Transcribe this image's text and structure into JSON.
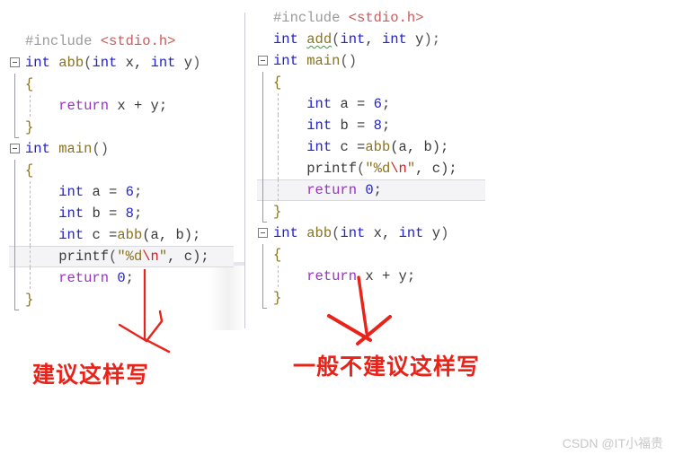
{
  "page": {
    "background": "#ffffff",
    "watermark": "CSDN @IT小福贵"
  },
  "colors": {
    "preprocessor": "#9a9a9a",
    "include_path": "#d05a5a",
    "keyword_type": "#2222cc",
    "keyword_return": "#9b30c8",
    "function_name": "#8a7320",
    "string_literal": "#8a7320",
    "escape_sequence": "#cc2222",
    "annotation_red": "#e8231a",
    "squiggle_green": "#2f9e2f",
    "current_line_highlight": "#f4f4f6"
  },
  "left_editor": {
    "name": "recommended-code",
    "lines": [
      {
        "fold": false,
        "rail": "none",
        "guide": false,
        "highlight": false,
        "tokens": [
          {
            "t": "#include ",
            "c": "k-pre"
          },
          {
            "t": "<stdio.h>",
            "c": "k-inc"
          }
        ]
      },
      {
        "fold": true,
        "rail": "none",
        "guide": false,
        "highlight": false,
        "tokens": [
          {
            "t": "int ",
            "c": "k-type"
          },
          {
            "t": "abb",
            "c": "k-fn"
          },
          {
            "t": "(",
            "c": "k-punct"
          },
          {
            "t": "int ",
            "c": "k-type"
          },
          {
            "t": "x, ",
            "c": "k-plain"
          },
          {
            "t": "int ",
            "c": "k-type"
          },
          {
            "t": "y",
            "c": "k-plain"
          },
          {
            "t": ")",
            "c": "k-punct"
          }
        ]
      },
      {
        "fold": false,
        "rail": "mid",
        "guide": false,
        "highlight": false,
        "tokens": [
          {
            "t": "{",
            "c": "k-brace"
          }
        ]
      },
      {
        "fold": false,
        "rail": "mid",
        "guide": true,
        "highlight": false,
        "tokens": [
          {
            "t": "    ",
            "c": "k-plain"
          },
          {
            "t": "return ",
            "c": "k-ret"
          },
          {
            "t": "x + y;",
            "c": "k-plain"
          }
        ]
      },
      {
        "fold": false,
        "rail": "end",
        "guide": false,
        "highlight": false,
        "tokens": [
          {
            "t": "}",
            "c": "k-brace"
          }
        ]
      },
      {
        "fold": true,
        "rail": "none",
        "guide": false,
        "highlight": false,
        "tokens": [
          {
            "t": "int ",
            "c": "k-type"
          },
          {
            "t": "main",
            "c": "k-fn"
          },
          {
            "t": "()",
            "c": "k-punct"
          }
        ]
      },
      {
        "fold": false,
        "rail": "mid",
        "guide": false,
        "highlight": false,
        "tokens": [
          {
            "t": "{",
            "c": "k-brace"
          }
        ]
      },
      {
        "fold": false,
        "rail": "mid",
        "guide": true,
        "highlight": false,
        "tokens": [
          {
            "t": "    ",
            "c": "k-plain"
          },
          {
            "t": "int ",
            "c": "k-type"
          },
          {
            "t": "a = ",
            "c": "k-plain"
          },
          {
            "t": "6",
            "c": "k-num"
          },
          {
            "t": ";",
            "c": "k-plain"
          }
        ]
      },
      {
        "fold": false,
        "rail": "mid",
        "guide": true,
        "highlight": false,
        "tokens": [
          {
            "t": "    ",
            "c": "k-plain"
          },
          {
            "t": "int ",
            "c": "k-type"
          },
          {
            "t": "b = ",
            "c": "k-plain"
          },
          {
            "t": "8",
            "c": "k-num"
          },
          {
            "t": ";",
            "c": "k-plain"
          }
        ]
      },
      {
        "fold": false,
        "rail": "mid",
        "guide": true,
        "highlight": false,
        "tokens": [
          {
            "t": "    ",
            "c": "k-plain"
          },
          {
            "t": "int ",
            "c": "k-type"
          },
          {
            "t": "c =",
            "c": "k-plain"
          },
          {
            "t": "abb",
            "c": "k-fn"
          },
          {
            "t": "(a, b);",
            "c": "k-plain"
          }
        ]
      },
      {
        "fold": false,
        "rail": "mid",
        "guide": true,
        "highlight": true,
        "tokens": [
          {
            "t": "    ",
            "c": "k-plain"
          },
          {
            "t": "printf",
            "c": "k-plain"
          },
          {
            "t": "(",
            "c": "k-punct"
          },
          {
            "t": "\"%d",
            "c": "k-str"
          },
          {
            "t": "\\n",
            "c": "k-esc"
          },
          {
            "t": "\"",
            "c": "k-str"
          },
          {
            "t": ", c);",
            "c": "k-plain"
          }
        ]
      },
      {
        "fold": false,
        "rail": "mid",
        "guide": true,
        "highlight": false,
        "tokens": [
          {
            "t": "    ",
            "c": "k-plain"
          },
          {
            "t": "return ",
            "c": "k-ret"
          },
          {
            "t": "0",
            "c": "k-num"
          },
          {
            "t": ";",
            "c": "k-plain"
          }
        ]
      },
      {
        "fold": false,
        "rail": "end",
        "guide": false,
        "highlight": false,
        "tokens": [
          {
            "t": "}",
            "c": "k-brace"
          }
        ]
      }
    ]
  },
  "right_editor": {
    "name": "not-recommended-code",
    "lines": [
      {
        "fold": false,
        "rail": "none",
        "guide": false,
        "highlight": false,
        "tokens": [
          {
            "t": "#include ",
            "c": "k-pre"
          },
          {
            "t": "<stdio.h>",
            "c": "k-inc"
          }
        ]
      },
      {
        "fold": false,
        "rail": "none",
        "guide": false,
        "highlight": false,
        "tokens": [
          {
            "t": "int ",
            "c": "k-type"
          },
          {
            "t": "add",
            "c": "k-fn squiggle"
          },
          {
            "t": "(",
            "c": "k-punct"
          },
          {
            "t": "int",
            "c": "k-type"
          },
          {
            "t": ", ",
            "c": "k-plain"
          },
          {
            "t": "int ",
            "c": "k-type"
          },
          {
            "t": "y",
            "c": "k-plain"
          },
          {
            "t": ");",
            "c": "k-punct"
          }
        ]
      },
      {
        "fold": true,
        "rail": "none",
        "guide": false,
        "highlight": false,
        "tokens": [
          {
            "t": "int ",
            "c": "k-type"
          },
          {
            "t": "main",
            "c": "k-fn"
          },
          {
            "t": "()",
            "c": "k-punct"
          }
        ]
      },
      {
        "fold": false,
        "rail": "mid",
        "guide": false,
        "highlight": false,
        "tokens": [
          {
            "t": "{",
            "c": "k-brace"
          }
        ]
      },
      {
        "fold": false,
        "rail": "mid",
        "guide": true,
        "highlight": false,
        "tokens": [
          {
            "t": "    ",
            "c": "k-plain"
          },
          {
            "t": "int ",
            "c": "k-type"
          },
          {
            "t": "a = ",
            "c": "k-plain"
          },
          {
            "t": "6",
            "c": "k-num"
          },
          {
            "t": ";",
            "c": "k-plain"
          }
        ]
      },
      {
        "fold": false,
        "rail": "mid",
        "guide": true,
        "highlight": false,
        "tokens": [
          {
            "t": "    ",
            "c": "k-plain"
          },
          {
            "t": "int ",
            "c": "k-type"
          },
          {
            "t": "b = ",
            "c": "k-plain"
          },
          {
            "t": "8",
            "c": "k-num"
          },
          {
            "t": ";",
            "c": "k-plain"
          }
        ]
      },
      {
        "fold": false,
        "rail": "mid",
        "guide": true,
        "highlight": false,
        "tokens": [
          {
            "t": "    ",
            "c": "k-plain"
          },
          {
            "t": "int ",
            "c": "k-type"
          },
          {
            "t": "c =",
            "c": "k-plain"
          },
          {
            "t": "abb",
            "c": "k-fn"
          },
          {
            "t": "(a, b);",
            "c": "k-plain"
          }
        ]
      },
      {
        "fold": false,
        "rail": "mid",
        "guide": true,
        "highlight": false,
        "tokens": [
          {
            "t": "    ",
            "c": "k-plain"
          },
          {
            "t": "printf",
            "c": "k-plain"
          },
          {
            "t": "(",
            "c": "k-punct"
          },
          {
            "t": "\"%d",
            "c": "k-str"
          },
          {
            "t": "\\n",
            "c": "k-esc"
          },
          {
            "t": "\"",
            "c": "k-str"
          },
          {
            "t": ", c);",
            "c": "k-plain"
          }
        ]
      },
      {
        "fold": false,
        "rail": "mid",
        "guide": true,
        "highlight": true,
        "tokens": [
          {
            "t": "    ",
            "c": "k-plain"
          },
          {
            "t": "return ",
            "c": "k-ret"
          },
          {
            "t": "0",
            "c": "k-num"
          },
          {
            "t": ";",
            "c": "k-plain"
          }
        ]
      },
      {
        "fold": false,
        "rail": "end",
        "guide": false,
        "highlight": false,
        "tokens": [
          {
            "t": "}",
            "c": "k-brace"
          }
        ]
      },
      {
        "fold": true,
        "rail": "none",
        "guide": false,
        "highlight": false,
        "tokens": [
          {
            "t": "int ",
            "c": "k-type"
          },
          {
            "t": "abb",
            "c": "k-fn"
          },
          {
            "t": "(",
            "c": "k-punct"
          },
          {
            "t": "int ",
            "c": "k-type"
          },
          {
            "t": "x, ",
            "c": "k-plain"
          },
          {
            "t": "int ",
            "c": "k-type"
          },
          {
            "t": "y",
            "c": "k-plain"
          },
          {
            "t": ")",
            "c": "k-punct"
          }
        ]
      },
      {
        "fold": false,
        "rail": "mid",
        "guide": false,
        "highlight": false,
        "tokens": [
          {
            "t": "{",
            "c": "k-brace"
          }
        ]
      },
      {
        "fold": false,
        "rail": "mid",
        "guide": true,
        "highlight": false,
        "tokens": [
          {
            "t": "    ",
            "c": "k-plain"
          },
          {
            "t": "return ",
            "c": "k-ret"
          },
          {
            "t": "x + y;",
            "c": "k-plain"
          }
        ]
      },
      {
        "fold": false,
        "rail": "end",
        "guide": false,
        "highlight": false,
        "tokens": [
          {
            "t": "}",
            "c": "k-brace"
          }
        ]
      }
    ]
  },
  "annotations": {
    "left_caption": "建议这样写",
    "right_caption": "一般不建议这样写",
    "left_arrow": "down-arrow",
    "right_arrow": "down-arrow"
  }
}
